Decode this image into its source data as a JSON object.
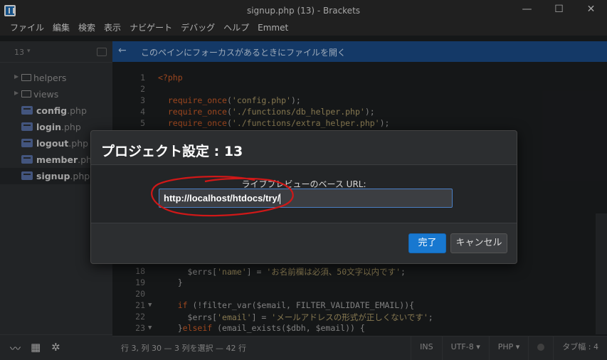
{
  "window": {
    "title": "signup.php (13) - Brackets",
    "minimize": "—",
    "maximize": "☐",
    "close": "✕"
  },
  "menu": [
    "ファイル",
    "編集",
    "検索",
    "表示",
    "ナビゲート",
    "デバッグ",
    "ヘルプ",
    "Emmet"
  ],
  "sidebar": {
    "project": "13",
    "project_caret": "▾",
    "items": [
      {
        "type": "folder",
        "name": "helpers",
        "ext": ""
      },
      {
        "type": "folder",
        "name": "views",
        "ext": ""
      },
      {
        "type": "file",
        "name": "config",
        "ext": ".php"
      },
      {
        "type": "file",
        "name": "login",
        "ext": ".php"
      },
      {
        "type": "file",
        "name": "logout",
        "ext": ".php"
      },
      {
        "type": "file",
        "name": "member",
        "ext": ".php"
      },
      {
        "type": "file",
        "name": "signup",
        "ext": ".php",
        "selected": true
      }
    ]
  },
  "banner": {
    "arrow": "←",
    "text": "このペインにフォーカスがあるときにファイルを開く"
  },
  "code_top": [
    {
      "ln": "1",
      "fold": "",
      "parts": [
        {
          "c": "kw",
          "t": "<?php"
        }
      ]
    },
    {
      "ln": "2",
      "fold": "",
      "parts": []
    },
    {
      "ln": "3",
      "fold": "",
      "parts": [
        {
          "c": "",
          "t": "  "
        },
        {
          "c": "kw",
          "t": "require_once"
        },
        {
          "c": "",
          "t": "("
        },
        {
          "c": "str",
          "t": "'config.php'"
        },
        {
          "c": "",
          "t": ");"
        }
      ]
    },
    {
      "ln": "4",
      "fold": "",
      "parts": [
        {
          "c": "",
          "t": "  "
        },
        {
          "c": "kw",
          "t": "require_once"
        },
        {
          "c": "",
          "t": "("
        },
        {
          "c": "str",
          "t": "'./functions/db_helper.php'"
        },
        {
          "c": "",
          "t": ");"
        }
      ]
    },
    {
      "ln": "5",
      "fold": "",
      "parts": [
        {
          "c": "",
          "t": "  "
        },
        {
          "c": "kw",
          "t": "require_once"
        },
        {
          "c": "",
          "t": "("
        },
        {
          "c": "str",
          "t": "'./functions/extra_helper.php'"
        },
        {
          "c": "",
          "t": ");"
        }
      ]
    }
  ],
  "code_bottom": [
    {
      "ln": "18",
      "fold": "",
      "parts": [
        {
          "c": "",
          "t": "      $errs["
        },
        {
          "c": "str",
          "t": "'name'"
        },
        {
          "c": "",
          "t": "] = "
        },
        {
          "c": "str",
          "t": "'お名前欄は必須、50文字以内です'"
        },
        {
          "c": "",
          "t": ";"
        }
      ]
    },
    {
      "ln": "19",
      "fold": "",
      "parts": [
        {
          "c": "",
          "t": "    }"
        }
      ]
    },
    {
      "ln": "20",
      "fold": "",
      "parts": []
    },
    {
      "ln": "21",
      "fold": "▼",
      "parts": [
        {
          "c": "",
          "t": "    "
        },
        {
          "c": "kw",
          "t": "if"
        },
        {
          "c": "",
          "t": " (!filter_var($email, FILTER_VALIDATE_EMAIL)){"
        }
      ]
    },
    {
      "ln": "22",
      "fold": "",
      "parts": [
        {
          "c": "",
          "t": "      $errs["
        },
        {
          "c": "str",
          "t": "'email'"
        },
        {
          "c": "",
          "t": "] = "
        },
        {
          "c": "str",
          "t": "'メールアドレスの形式が正しくないです'"
        },
        {
          "c": "",
          "t": ";"
        }
      ]
    },
    {
      "ln": "23",
      "fold": "▼",
      "parts": [
        {
          "c": "",
          "t": "    }"
        },
        {
          "c": "kw",
          "t": "elseif"
        },
        {
          "c": "",
          "t": " (email_exists($dbh, $email)) {"
        }
      ]
    }
  ],
  "status": {
    "position": "行 3, 列 30 — 3 列を選択 — 42 行",
    "ins": "INS",
    "encoding": "UTF-8 ▾",
    "language": "PHP ▾",
    "indent": "タブ幅 : 4"
  },
  "dialog": {
    "title": "プロジェクト設定 : 13",
    "label": "ライブプレビューのベース URL:",
    "url_value": "http://localhost/htdocs/try/",
    "ok": "完了",
    "cancel": "キャンセル"
  },
  "tools": {
    "live": "〰",
    "ext": "▦",
    "wand": "✲"
  }
}
